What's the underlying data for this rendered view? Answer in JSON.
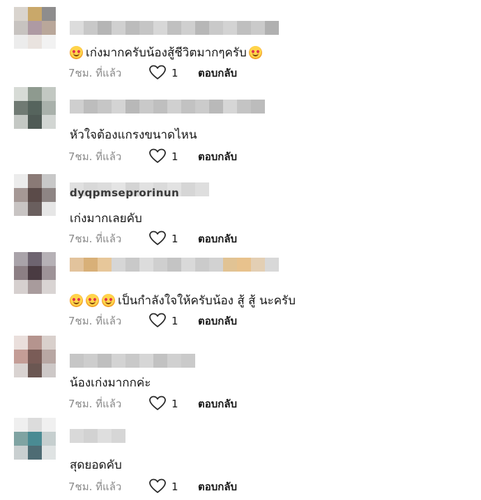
{
  "comments": [
    {
      "username": "",
      "text": "เก่งมากครับน้องสู้ชีวิตมากๆครับ",
      "emoji_before": 1,
      "emoji_after": 1,
      "time": "7ชม. ที่แล้ว",
      "likes": "1",
      "reply": "ตอบกลับ",
      "avatar_colors": [
        "#d9d4ce",
        "#c9a86a",
        "#8e8d8d",
        "#c7c3c0",
        "#ae9aa3",
        "#b9a79a",
        "#ececec",
        "#e9e3df",
        "#f2f2f2"
      ],
      "name_colors": [
        "#dcdcdc",
        "#c8c8c8",
        "#b5b5b5",
        "#d0d0d0",
        "#bcbcbc",
        "#c5c5c5",
        "#d7d7d7",
        "#c0c0c0",
        "#cfcfcf",
        "#b7b7b7",
        "#c9c9c9",
        "#d3d3d3",
        "#bfbfbf",
        "#cacaca",
        "#b0b0b0"
      ]
    },
    {
      "username": "",
      "text": "หัวใจต้องแกรงขนาดไหน",
      "emoji_before": 0,
      "emoji_after": 0,
      "time": "7ชม. ที่แล้ว",
      "likes": "1",
      "reply": "ตอบกลับ",
      "avatar_colors": [
        "#d7dbd6",
        "#8e9a8f",
        "#c2c8c2",
        "#707a73",
        "#56645d",
        "#a9b1ab",
        "#c4c8c4",
        "#4f5a55",
        "#d2d6d3"
      ],
      "name_colors": [
        "#cfcfcf",
        "#bdbdbd",
        "#c6c6c6",
        "#d4d4d4",
        "#b8b8b8",
        "#c9c9c9",
        "#bfbfbf",
        "#d0d0d0",
        "#c2c2c2",
        "#cbcbcb",
        "#b9b9b9",
        "#d6d6d6",
        "#c4c4c4",
        "#bcbcbc"
      ]
    },
    {
      "username": "dyqpmseprorinun",
      "text": "เก่งมากเลยคับ",
      "emoji_before": 0,
      "emoji_after": 0,
      "time": "7ชม. ที่แล้ว",
      "likes": "1",
      "reply": "ตอบกลับ",
      "avatar_colors": [
        "#ececec",
        "#8a7a76",
        "#c8c8c8",
        "#a59895",
        "#5b4b49",
        "#8e8584",
        "#c8c4c3",
        "#6a5f5e",
        "#e6e6e6"
      ],
      "name_colors": [
        "#e0e0e0",
        "#d8d8d8",
        "#dcdcdc",
        "#e4e4e4",
        "#d4d4d4",
        "#e1e1e1",
        "#dadada",
        "#e2e2e2",
        "#d6d6d6",
        "#dedede"
      ]
    },
    {
      "username": "",
      "text": "เป็นกำลังใจให้ครับน้อง สู้ สู้ นะครับ",
      "emoji_before": 3,
      "emoji_after": 0,
      "time": "7ชม. ที่แล้ว",
      "likes": "1",
      "reply": "ตอบกลับ",
      "avatar_colors": [
        "#a9a3a9",
        "#6e6470",
        "#b6b1b6",
        "#8c7f84",
        "#4a3b42",
        "#9e9398",
        "#d6d0cf",
        "#a89b9c",
        "#d9d4d3"
      ],
      "name_colors": [
        "#e2c39c",
        "#d8b078",
        "#e7c79a",
        "#d6d6d6",
        "#c9c9c9",
        "#dcdcdc",
        "#cfcfcf",
        "#c4c4c4",
        "#d9d9d9",
        "#cbcbcb",
        "#d2d2d2",
        "#e1c394",
        "#e8c28d",
        "#e3cfb4",
        "#d8d8d8"
      ]
    },
    {
      "username": "",
      "text": "น้องเก่งมากกค่ะ",
      "emoji_before": 0,
      "emoji_after": 0,
      "time": "7ชม. ที่แล้ว",
      "likes": "1",
      "reply": "ตอบกลับ",
      "avatar_colors": [
        "#eadfdc",
        "#b5948e",
        "#d9d0cc",
        "#c49d96",
        "#7a5c57",
        "#b8a7a3",
        "#d9d3d1",
        "#6b5752",
        "#cdc8c7"
      ],
      "name_colors": [
        "#c6c6c6",
        "#cdcdcd",
        "#bfbfbf",
        "#d3d3d3",
        "#c9c9c9",
        "#d6d6d6",
        "#c2c2c2",
        "#d0d0d0",
        "#cacaca"
      ]
    },
    {
      "username": "",
      "text": "สุดยอดคับ",
      "emoji_before": 0,
      "emoji_after": 0,
      "time": "7ชม. ที่แล้ว",
      "likes": "1",
      "reply": "ตอบกลับ",
      "avatar_colors": [
        "#efefef",
        "#dcdcdc",
        "#f0f0f0",
        "#7fa3a2",
        "#4a8b93",
        "#c6cfcf",
        "#c9cfd0",
        "#4e6c74",
        "#dfe3e3"
      ],
      "name_colors": [
        "#d9d9d9",
        "#d2d2d2",
        "#dedede",
        "#d6d6d6"
      ]
    }
  ],
  "colors": {
    "meta_text": "#8a8a8a",
    "body_text": "#161616"
  }
}
